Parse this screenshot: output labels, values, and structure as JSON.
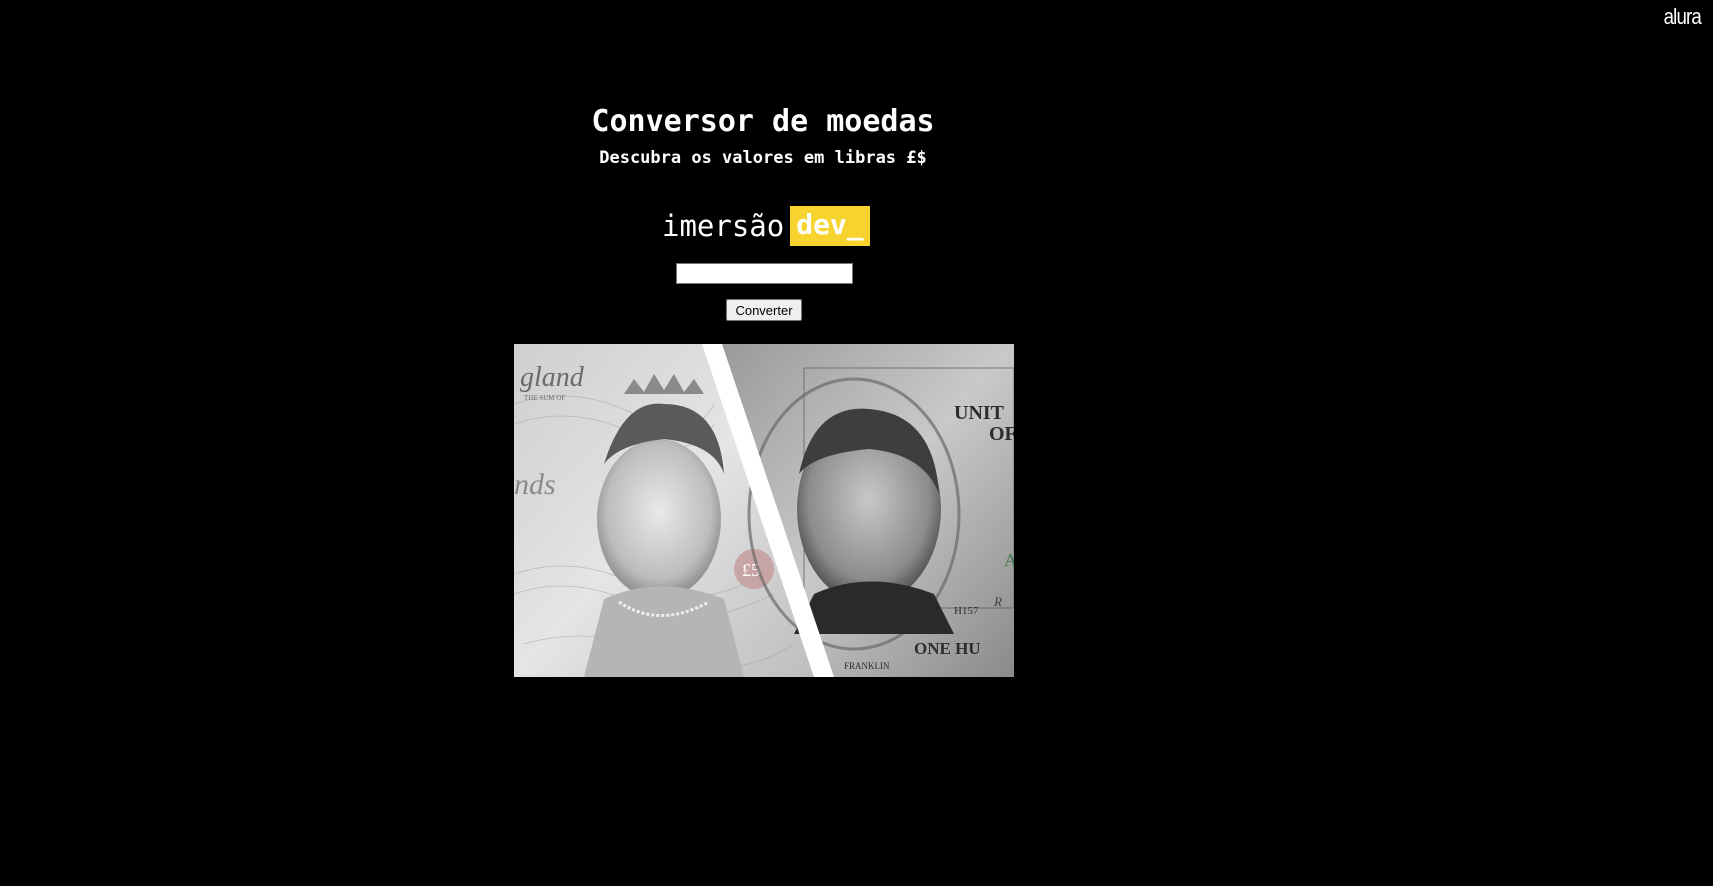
{
  "brand": {
    "name": "alura"
  },
  "header": {
    "title": "Conversor de moedas",
    "subtitle": "Descubra os valores em libras £$"
  },
  "logo": {
    "light_text": "imersão",
    "badge_text": "dev_",
    "badge_color": "#f6d32d"
  },
  "form": {
    "amount_value": "",
    "amount_placeholder": "",
    "convert_label": "Converter"
  },
  "hero_image": {
    "left_note": "british-pound-banknote",
    "right_note": "us-hundred-dollar-banknote",
    "visible_text": {
      "left_top": "gland",
      "left_small": "THE SUM OF",
      "left_mid": "nds",
      "left_badge": "£5",
      "right_top": "UNIT",
      "right_top2": "OF",
      "right_serial": "H157",
      "right_bottom": "ONE HU",
      "right_name": "FRANKLIN",
      "right_green": "A",
      "right_sign": "R"
    }
  },
  "colors": {
    "background": "#000000",
    "text": "#ffffff",
    "accent": "#f6d32d"
  }
}
